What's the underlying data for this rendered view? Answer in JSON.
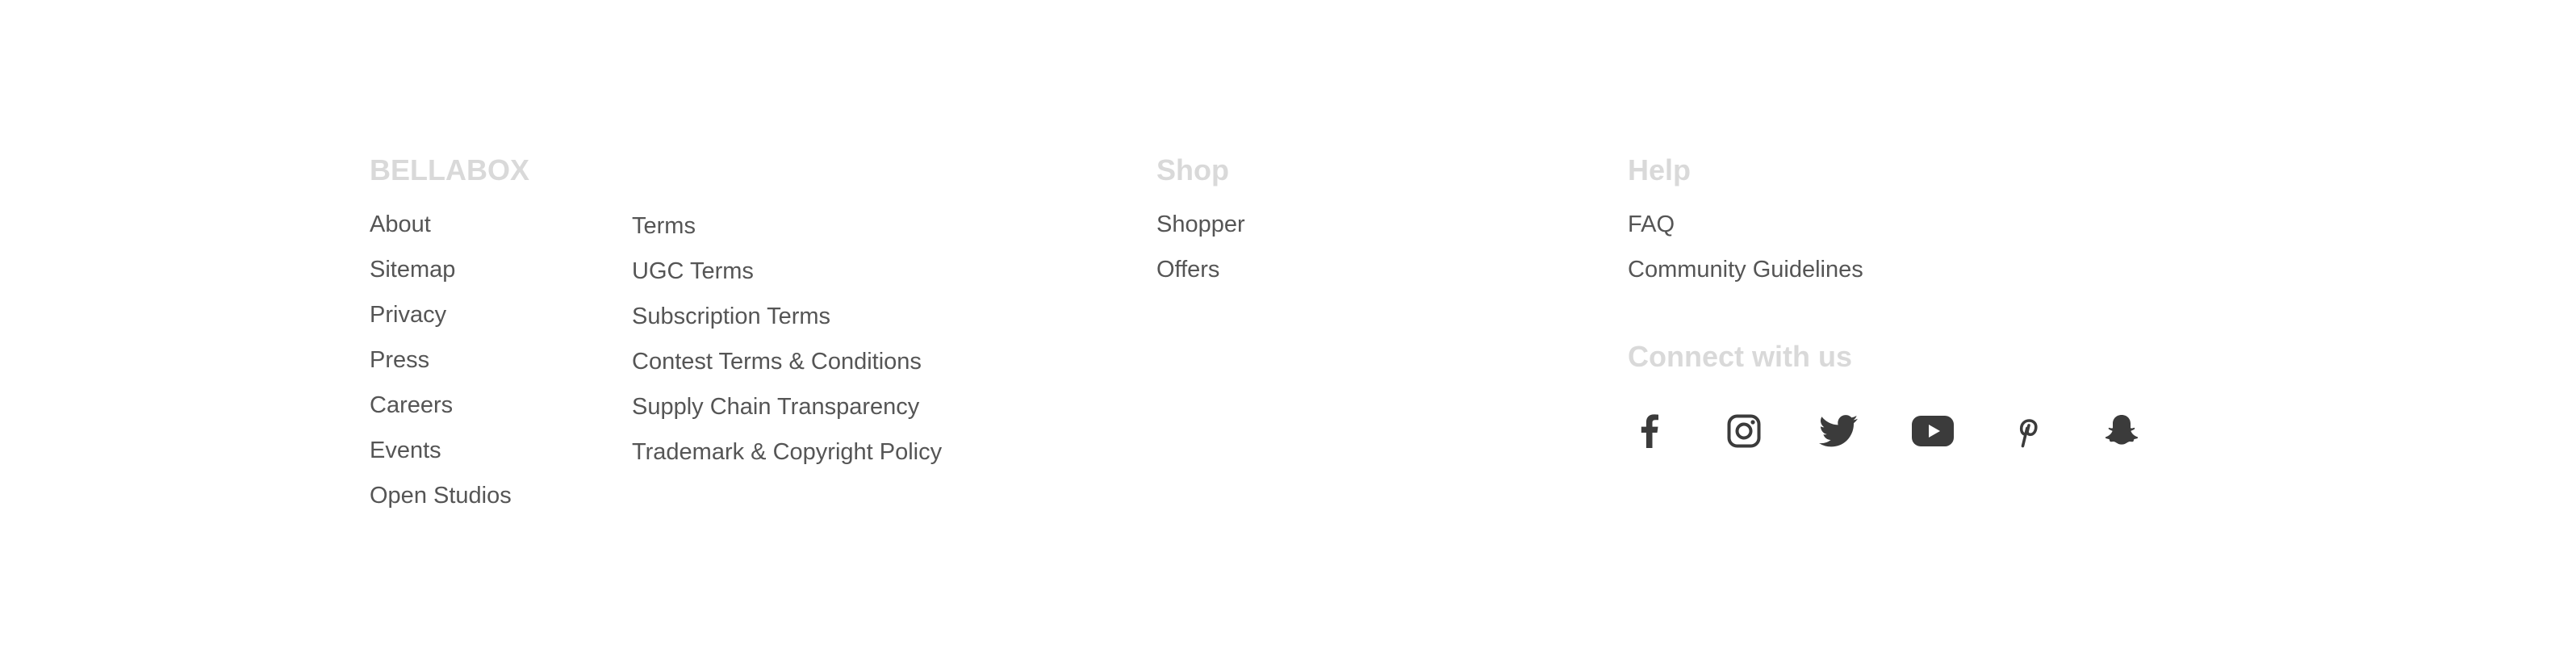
{
  "footer": {
    "brand": {
      "heading": "BELLABOX",
      "col1": [
        "About",
        "Sitemap",
        "Privacy",
        "Press",
        "Careers",
        "Events",
        "Open Studios"
      ],
      "col2": [
        "Terms",
        "UGC Terms",
        "Subscription Terms",
        "Contest Terms & Conditions",
        "Supply Chain Transparency",
        "Trademark & Copyright Policy"
      ]
    },
    "shop": {
      "heading": "Shop",
      "links": [
        "Shopper",
        "Offers"
      ]
    },
    "help": {
      "heading": "Help",
      "links": [
        "FAQ",
        "Community Guidelines"
      ]
    },
    "connect": {
      "heading": "Connect with us",
      "icons": [
        "facebook-icon",
        "instagram-icon",
        "twitter-icon",
        "youtube-icon",
        "pinterest-icon",
        "snapchat-icon"
      ]
    },
    "colors": {
      "heading": "#d9d9d9",
      "link": "#555555",
      "icon": "#3b3b3b",
      "background": "#ffffff"
    }
  }
}
